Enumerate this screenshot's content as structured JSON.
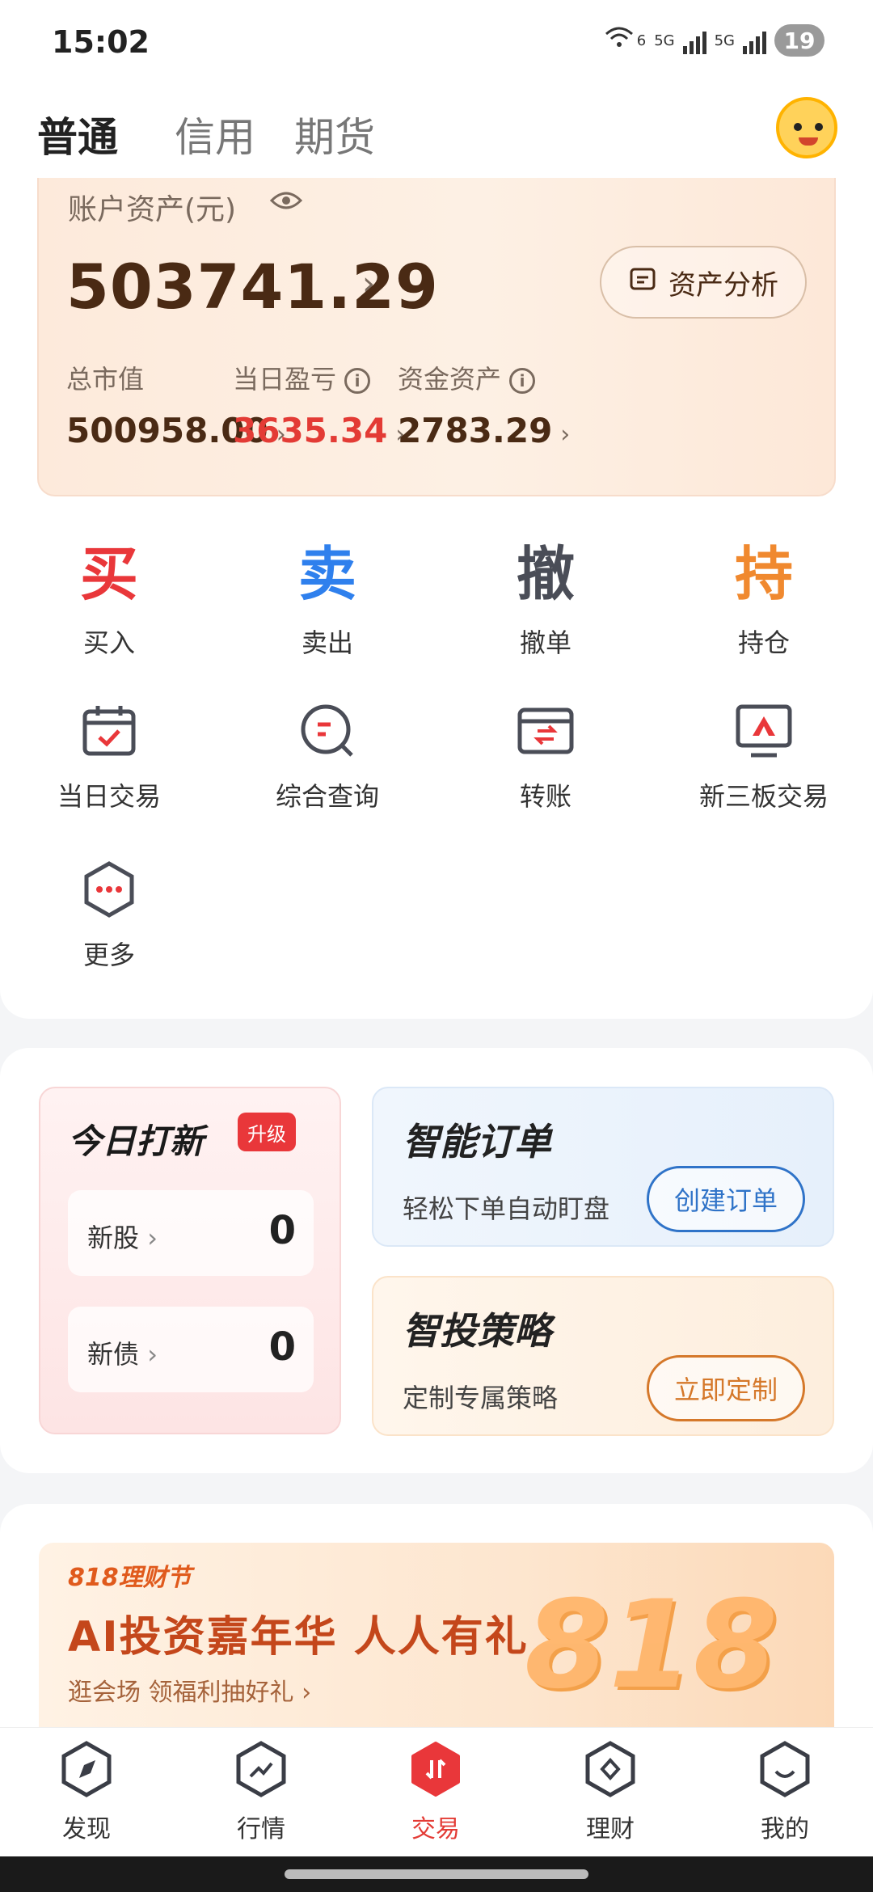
{
  "status_bar": {
    "time": "15:02",
    "net1": "5G",
    "net2": "5G",
    "wifi_badge": "6",
    "battery": "19"
  },
  "header": {
    "tabs": [
      "普通",
      "信用",
      "期货"
    ],
    "active_tab": 0
  },
  "account": {
    "label": "账户资产(元)",
    "total": "503741.29",
    "analysis_button": "资产分析",
    "stats": [
      {
        "label": "总市值",
        "value": "500958.00"
      },
      {
        "label": "当日盈亏",
        "value": "3635.34"
      },
      {
        "label": "资金资产",
        "value": "2783.29"
      }
    ]
  },
  "big_actions": [
    {
      "char": "买",
      "label": "买入",
      "color": "#e9373a"
    },
    {
      "char": "卖",
      "label": "卖出",
      "color": "#2f80ed"
    },
    {
      "char": "撤",
      "label": "撤单",
      "color": "#4a4d57"
    },
    {
      "char": "持",
      "label": "持仓",
      "color": "#f0892f"
    }
  ],
  "icon_actions": [
    {
      "label": "当日交易",
      "icon": "calendar-check-icon"
    },
    {
      "label": "综合查询",
      "icon": "search-list-icon"
    },
    {
      "label": "转账",
      "icon": "transfer-icon"
    },
    {
      "label": "新三板交易",
      "icon": "board-icon"
    },
    {
      "label": "更多",
      "icon": "more-hex-icon"
    }
  ],
  "ipo": {
    "title": "今日打新",
    "badge": "升级",
    "rows": [
      {
        "label": "新股",
        "value": "0"
      },
      {
        "label": "新债",
        "value": "0"
      }
    ]
  },
  "smart_order": {
    "title": "智能订单",
    "subtitle": "轻松下单自动盯盘",
    "button": "创建订单",
    "accent": "#2f73c8"
  },
  "strategy": {
    "title": "智投策略",
    "subtitle": "定制专属策略",
    "button": "立即定制",
    "accent": "#d5782a"
  },
  "banner": {
    "logo": "818理财节",
    "title": "AI投资嘉年华 人人有礼",
    "subtitle": "逛会场 领福利抽好礼",
    "big": "818"
  },
  "nav": {
    "items": [
      {
        "label": "发现",
        "icon": "compass-icon"
      },
      {
        "label": "行情",
        "icon": "trend-icon"
      },
      {
        "label": "交易",
        "icon": "trade-icon"
      },
      {
        "label": "理财",
        "icon": "wealth-icon"
      },
      {
        "label": "我的",
        "icon": "profile-icon"
      }
    ],
    "active": 2
  }
}
